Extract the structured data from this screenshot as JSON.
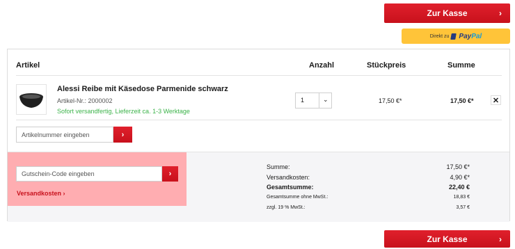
{
  "buttons": {
    "checkout_top": "Zur Kasse",
    "checkout_bottom": "Zur Kasse",
    "paypal_prefix": "Direkt zu",
    "paypal_brand_a": "Pay",
    "paypal_brand_b": "Pal"
  },
  "cart": {
    "headers": {
      "article": "Artikel",
      "quantity": "Anzahl",
      "unit_price": "Stückpreis",
      "total": "Summe"
    },
    "item": {
      "name": "Alessi Reibe mit Käsedose Parmenide schwarz",
      "number": "Artikel-Nr.: 2000002",
      "shipping": "Sofort versandfertig, Lieferzeit ca. 1-3 Werktage",
      "quantity": "1",
      "unit_price": "17,50 €*",
      "total": "17,50 €*",
      "remove": "✕"
    },
    "article_input_placeholder": "Artikelnummer eingeben",
    "coupon_input_placeholder": "Gutschein-Code eingeben",
    "shipping_link": "Versandkosten ›"
  },
  "summary": {
    "rows": [
      {
        "label": "Summe:",
        "value": "17,50 €*"
      },
      {
        "label": "Versandkosten:",
        "value": "4,90 €*"
      },
      {
        "label": "Gesamtsumme:",
        "value": "22,40 €"
      },
      {
        "label": "Gesamtsumme ohne MwSt.:",
        "value": "18,83 €"
      },
      {
        "label": "zzgl. 19 % MwSt.:",
        "value": "3,57 €"
      }
    ]
  },
  "colors": {
    "accent": "#d21a24",
    "paypal": "#ffc439",
    "coupon_highlight": "#ffadb1",
    "in_stock": "#3cb34a"
  }
}
